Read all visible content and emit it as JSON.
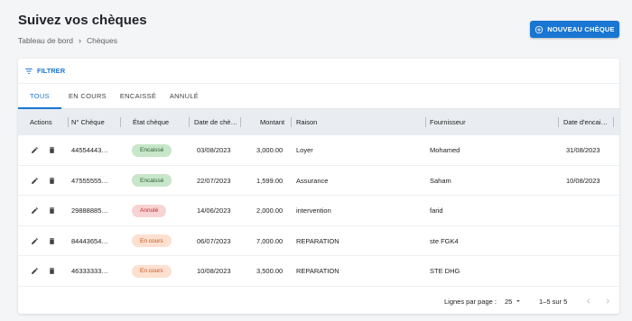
{
  "header": {
    "title": "Suivez vos chèques",
    "breadcrumb": {
      "root": "Tableau de bord",
      "current": "Chèques"
    },
    "new_button_label": "NOUVEAU CHÈQUE"
  },
  "toolbar": {
    "filter_label": "FILTRER"
  },
  "tabs": [
    {
      "label": "TOUS",
      "active": true
    },
    {
      "label": "EN COURS",
      "active": false
    },
    {
      "label": "ENCAISSÉ",
      "active": false
    },
    {
      "label": "ANNULÉ",
      "active": false
    }
  ],
  "table": {
    "columns": {
      "actions": "Actions",
      "number": "N° Chèque",
      "state": "État chèque",
      "date": "Date de chè…",
      "amount": "Montant",
      "reason": "Raison",
      "supplier": "Fournisseur",
      "cash_date": "Date d'encai…"
    },
    "rows": [
      {
        "number": "44554443…",
        "state": "Encaissé",
        "state_type": "cashed",
        "date": "03/08/2023",
        "amount": "3,000.00",
        "reason": "Loyer",
        "supplier": "Mohamed",
        "cash_date": "31/08/2023"
      },
      {
        "number": "47555555…",
        "state": "Encaissé",
        "state_type": "cashed",
        "date": "22/07/2023",
        "amount": "1,599.00",
        "reason": "Assurance",
        "supplier": "Saham",
        "cash_date": "10/08/2023"
      },
      {
        "number": "29888885…",
        "state": "Annulé",
        "state_type": "cancelled",
        "date": "14/06/2023",
        "amount": "2,000.00",
        "reason": "intervention",
        "supplier": "farid",
        "cash_date": ""
      },
      {
        "number": "84443654…",
        "state": "En cours",
        "state_type": "pending",
        "date": "06/07/2023",
        "amount": "7,000.00",
        "reason": "REPARATION",
        "supplier": "ste FGK4",
        "cash_date": ""
      },
      {
        "number": "46333333…",
        "state": "En cours",
        "state_type": "pending",
        "date": "10/08/2023",
        "amount": "3,500.00",
        "reason": "REPARATION",
        "supplier": "STE DHG",
        "cash_date": ""
      }
    ]
  },
  "pagination": {
    "rows_per_page_label": "Lignes par page :",
    "rows_per_page_value": "25",
    "range_label": "1–5 sur 5"
  },
  "colors": {
    "accent": "#1976d2",
    "chip_cashed_bg": "#c8e6c9",
    "chip_cashed_fg": "#2e5e31",
    "chip_cancelled_bg": "#f8d3d3",
    "chip_cancelled_fg": "#c62828",
    "chip_pending_bg": "#fde0d0",
    "chip_pending_fg": "#c8501b"
  }
}
